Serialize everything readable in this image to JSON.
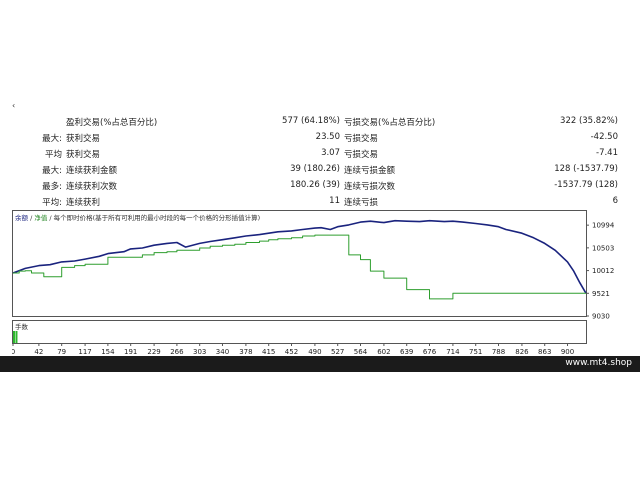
{
  "corner_mark": "‹",
  "stats": {
    "rows": [
      {
        "prefix": "",
        "label": "盈利交易(%占总百分比)",
        "value": "577 (64.18%)",
        "label2": "亏损交易(%占总百分比)",
        "value2": "322 (35.82%)"
      },
      {
        "prefix": "最大:",
        "label": "获利交易",
        "value": "23.50",
        "label2": "亏损交易",
        "value2": "-42.50"
      },
      {
        "prefix": "平均",
        "label": "获利交易",
        "value": "3.07",
        "label2": "亏损交易",
        "value2": "-7.41"
      },
      {
        "prefix": "最大:",
        "label": "连续获利金额",
        "value": "39 (180.26)",
        "label2": "连续亏损金额",
        "value2": "128 (-1537.79)"
      },
      {
        "prefix": "最多:",
        "label": "连续获利次数",
        "value": "180.26 (39)",
        "label2": "连续亏损次数",
        "value2": "-1537.79 (128)"
      },
      {
        "prefix": "平均:",
        "label": "连续获利",
        "value": "11",
        "label2": "连续亏损",
        "value2": "6"
      }
    ]
  },
  "chart_header": {
    "balance": "余额",
    "sep": " / ",
    "equity": "净值",
    "rest": " / 每个即时价格(基于所有可利用的最小时段的每一个价格的分形插值计算)"
  },
  "volume_label": "手数",
  "colors": {
    "balance_line": "#1a237e",
    "equity_line": "#2e9e2e",
    "volume_bar": "#2eb82e",
    "footer_bg": "#1b1b1b"
  },
  "chart_data": {
    "type": "line",
    "title": "",
    "xlabel": "",
    "ylabel": "",
    "ylim": [
      9030,
      11300
    ],
    "xlim": [
      0,
      930
    ],
    "x_ticks": [
      0,
      42,
      79,
      117,
      154,
      191,
      229,
      266,
      303,
      340,
      378,
      415,
      452,
      490,
      527,
      564,
      602,
      639,
      676,
      714,
      751,
      788,
      826,
      863,
      900
    ],
    "y_ticks": [
      10994,
      10503,
      10012,
      9521,
      9030
    ],
    "series": [
      {
        "name": "余额",
        "x": [
          0,
          20,
          42,
          60,
          79,
          100,
          117,
          140,
          154,
          180,
          191,
          210,
          229,
          250,
          266,
          280,
          303,
          320,
          340,
          360,
          378,
          400,
          415,
          430,
          452,
          470,
          490,
          500,
          515,
          527,
          545,
          564,
          580,
          602,
          620,
          639,
          660,
          676,
          700,
          714,
          730,
          751,
          770,
          788,
          800,
          826,
          845,
          863,
          880,
          900,
          910,
          920,
          930
        ],
        "y": [
          9960,
          10060,
          10120,
          10140,
          10200,
          10220,
          10260,
          10320,
          10380,
          10420,
          10480,
          10500,
          10560,
          10600,
          10620,
          10520,
          10600,
          10640,
          10680,
          10720,
          10760,
          10790,
          10820,
          10850,
          10870,
          10900,
          10930,
          10940,
          10900,
          10960,
          11000,
          11060,
          11080,
          11050,
          11090,
          11080,
          11070,
          11090,
          11070,
          11080,
          11060,
          11030,
          11000,
          10960,
          10900,
          10820,
          10720,
          10600,
          10450,
          10200,
          10000,
          9750,
          9520
        ]
      },
      {
        "name": "净值",
        "x": [
          0,
          10,
          20,
          30,
          42,
          50,
          60,
          79,
          100,
          117,
          140,
          154,
          170,
          191,
          210,
          229,
          250,
          266,
          280,
          303,
          320,
          340,
          360,
          378,
          400,
          415,
          430,
          452,
          470,
          490,
          500,
          515,
          527,
          545,
          564,
          580,
          602,
          620,
          639,
          660,
          676,
          700,
          714,
          751,
          788,
          826,
          863,
          900,
          930
        ],
        "y": [
          9960,
          10000,
          10010,
          9960,
          9960,
          9880,
          9880,
          10080,
          10120,
          10150,
          10150,
          10300,
          10300,
          10300,
          10350,
          10400,
          10420,
          10450,
          10450,
          10500,
          10540,
          10560,
          10580,
          10620,
          10650,
          10680,
          10700,
          10720,
          10760,
          10780,
          10780,
          10780,
          10780,
          10350,
          10250,
          10000,
          9850,
          9850,
          9600,
          9600,
          9400,
          9400,
          9520,
          9520,
          9520,
          9520,
          9520,
          9520,
          9520
        ]
      }
    ],
    "volume": {
      "name": "手数",
      "x": [
        0,
        4
      ],
      "values": [
        1,
        1
      ]
    }
  },
  "footer": {
    "site": "www.mt4.shop"
  }
}
